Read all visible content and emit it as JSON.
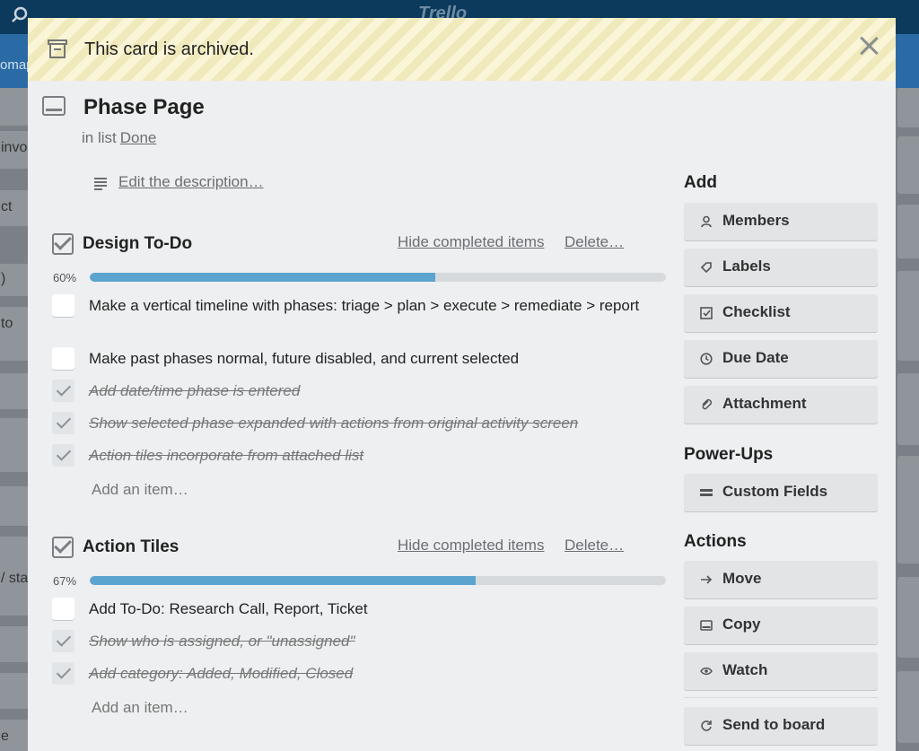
{
  "board": {
    "logo": "Trello",
    "name_fragment": "omap",
    "left_card_fragments": [
      "invo",
      "ct",
      ")",
      "to",
      "/ sta",
      "e"
    ]
  },
  "banner": {
    "text": "This card is archived."
  },
  "card": {
    "title": "Phase Page",
    "in_list_prefix": "in list",
    "list_name": "Done",
    "edit_description": "Edit the description…"
  },
  "checklists": [
    {
      "title": "Design To-Do",
      "hide_completed": "Hide completed items",
      "delete": "Delete…",
      "progress_label": "60%",
      "progress": 0.6,
      "items": [
        {
          "text": "Make a vertical timeline with phases: triage > plan > execute > remediate > report",
          "done": false
        },
        {
          "text": "Make past phases normal, future disabled, and current selected",
          "done": false
        },
        {
          "text": "Add date/time phase is entered",
          "done": true
        },
        {
          "text": "Show selected phase expanded with actions from original activity screen",
          "done": true
        },
        {
          "text": "Action tiles incorporate from attached list",
          "done": true
        }
      ],
      "add_item": "Add an item…"
    },
    {
      "title": "Action Tiles",
      "hide_completed": "Hide completed items",
      "delete": "Delete…",
      "progress_label": "67%",
      "progress": 0.67,
      "items": [
        {
          "text": "Add To-Do: Research Call, Report, Ticket",
          "done": false
        },
        {
          "text": "Show who is assigned, or \"unassigned\"",
          "done": true
        },
        {
          "text": "Add category: Added, Modified, Closed",
          "done": true
        }
      ],
      "add_item": "Add an item…"
    }
  ],
  "sidebar": {
    "add_heading": "Add",
    "add_buttons": [
      {
        "label": "Members",
        "icon": "person-icon"
      },
      {
        "label": "Labels",
        "icon": "tag-icon"
      },
      {
        "label": "Checklist",
        "icon": "checkbox-icon"
      },
      {
        "label": "Due Date",
        "icon": "clock-icon"
      },
      {
        "label": "Attachment",
        "icon": "paperclip-icon"
      }
    ],
    "powerups_heading": "Power-Ups",
    "powerups_buttons": [
      {
        "label": "Custom Fields",
        "icon": "fields-icon"
      }
    ],
    "actions_heading": "Actions",
    "actions_buttons": [
      {
        "label": "Move",
        "icon": "arrow-right-icon"
      },
      {
        "label": "Copy",
        "icon": "card-icon"
      },
      {
        "label": "Watch",
        "icon": "eye-icon"
      }
    ],
    "send_to_board": {
      "label": "Send to board",
      "icon": "refresh-icon"
    }
  }
}
